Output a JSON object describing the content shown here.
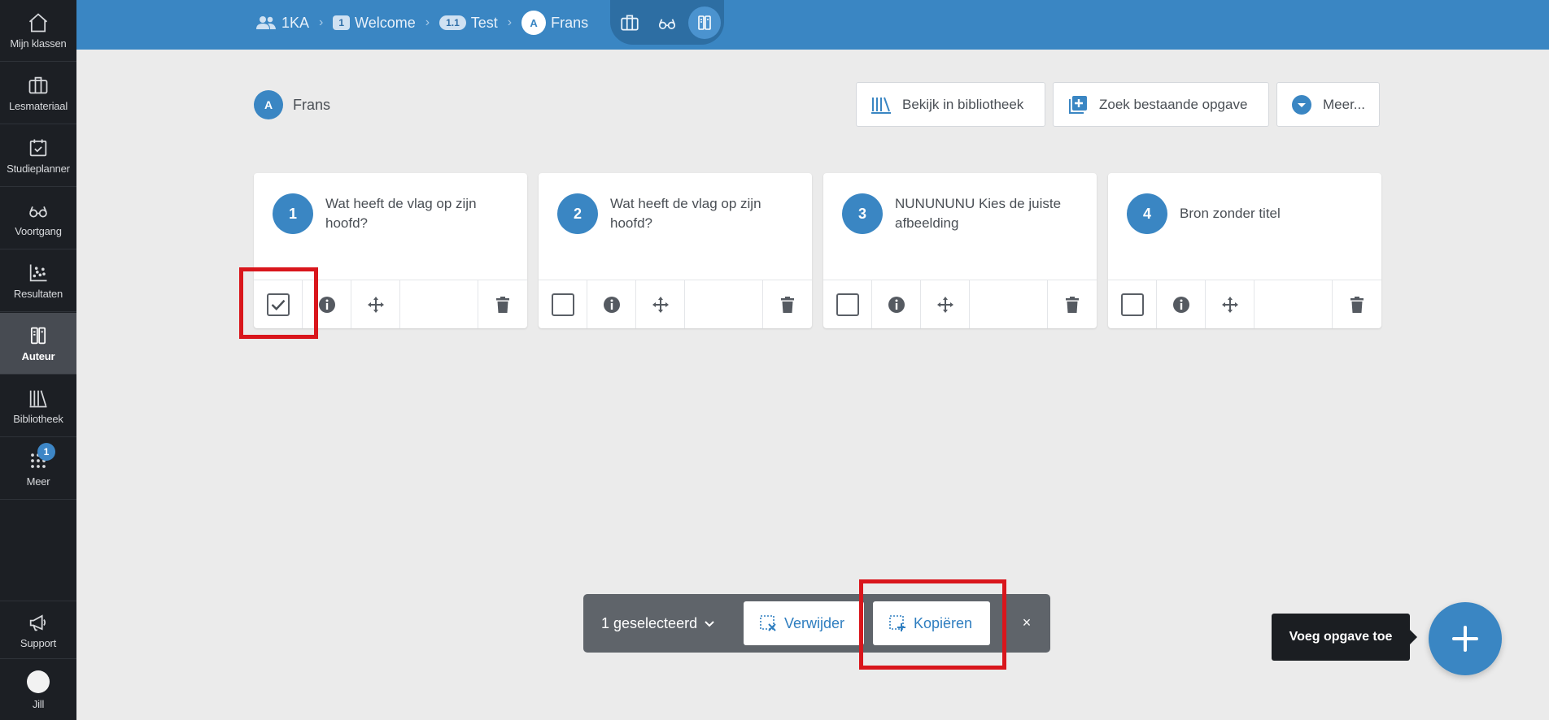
{
  "sidebar": {
    "items": [
      {
        "label": "Mijn klassen",
        "icon": "home-icon"
      },
      {
        "label": "Lesmateriaal",
        "icon": "briefcase-icon"
      },
      {
        "label": "Studieplanner",
        "icon": "calendar-check-icon"
      },
      {
        "label": "Voortgang",
        "icon": "glasses-icon"
      },
      {
        "label": "Resultaten",
        "icon": "scatter-chart-icon"
      },
      {
        "label": "Auteur",
        "icon": "author-icon"
      },
      {
        "label": "Bibliotheek",
        "icon": "library-icon"
      },
      {
        "label": "Meer",
        "icon": "grid-icon",
        "badge": "1"
      }
    ],
    "support_label": "Support",
    "user_label": "Jill"
  },
  "breadcrumb": {
    "class_name": "1KA",
    "chapter_num": "1",
    "chapter": "Welcome",
    "section_num": "1.1",
    "section": "Test",
    "item_initial": "A",
    "item": "Frans"
  },
  "header": {
    "avatar_initial": "A",
    "title": "Frans",
    "library_button": "Bekijk in bibliotheek",
    "search_button": "Zoek bestaande opgave",
    "more_button": "Meer..."
  },
  "cards": [
    {
      "num": "1",
      "title": "Wat heeft de vlag op zijn hoofd?",
      "checked": true
    },
    {
      "num": "2",
      "title": "Wat heeft de vlag op zijn hoofd?",
      "checked": false
    },
    {
      "num": "3",
      "title": "NUNUNUNU Kies de juiste afbeelding",
      "checked": false
    },
    {
      "num": "4",
      "title": "Bron zonder titel",
      "checked": false
    }
  ],
  "selection": {
    "count_label": "1 geselecteerd",
    "delete_label": "Verwijder",
    "copy_label": "Kopiëren",
    "close_label": "×"
  },
  "fab": {
    "tooltip": "Voeg opgave toe"
  },
  "colors": {
    "accent": "#3a86c3",
    "sidebar": "#1c1f24",
    "highlight": "#d9161c"
  }
}
